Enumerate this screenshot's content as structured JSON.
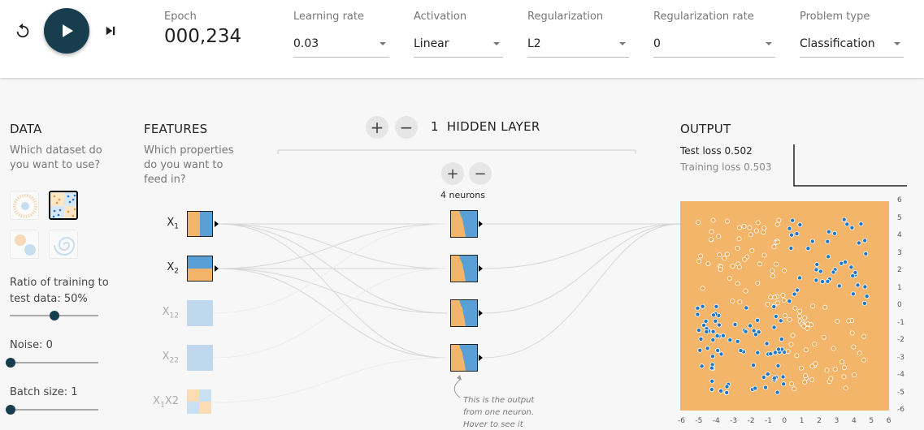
{
  "controls": {
    "reset": "reset-icon",
    "play": "play-icon",
    "step": "step-forward-icon"
  },
  "epoch": {
    "label": "Epoch",
    "value": "000,234"
  },
  "dropdowns": [
    {
      "label": "Learning rate",
      "value": "0.03"
    },
    {
      "label": "Activation",
      "value": "Linear"
    },
    {
      "label": "Regularization",
      "value": "L2"
    },
    {
      "label": "Regularization rate",
      "value": "0"
    },
    {
      "label": "Problem type",
      "value": "Classification"
    }
  ],
  "data": {
    "title": "DATA",
    "subtitle_line1": "Which dataset do",
    "subtitle_line2": "you want to use?",
    "datasets": [
      "circle",
      "xor",
      "gaussian",
      "spiral"
    ],
    "selected": "xor",
    "ratio_label_line1": "Ratio of training to",
    "ratio_label_line2": "test data:  50%",
    "ratio_value": 50,
    "noise_label": "Noise:  0",
    "noise_value": 0,
    "batch_label": "Batch size:  1",
    "batch_value": 1
  },
  "features": {
    "title": "FEATURES",
    "subtitle_line1": "Which properties",
    "subtitle_line2": "do you want to",
    "subtitle_line3": "feed in?",
    "items": [
      {
        "base": "X",
        "sub": "1",
        "sub2": "",
        "active": true
      },
      {
        "base": "X",
        "sub": "2",
        "sub2": "",
        "active": true
      },
      {
        "base": "X",
        "sub": "1",
        "sub2": "2",
        "active": false
      },
      {
        "base": "X",
        "sub": "2",
        "sub2": "2",
        "active": false
      },
      {
        "base": "X",
        "sub": "1",
        "sub2": "X2",
        "active": false
      }
    ]
  },
  "hidden": {
    "add_layer": "+",
    "remove_layer": "−",
    "count": "1",
    "title": "HIDDEN LAYER",
    "add_neuron": "+",
    "remove_neuron": "−",
    "neurons_label": "4 neurons",
    "neuron_count": 4,
    "callout_line1": "This is the output",
    "callout_line2": "from one neuron.",
    "callout_line3": "Hover to see it"
  },
  "output": {
    "title": "OUTPUT",
    "test_loss": "Test loss 0.502",
    "training_loss": "Training loss 0.503",
    "y_ticks": [
      "6",
      "5",
      "4",
      "3",
      "2",
      "1",
      "0",
      "-1",
      "-2",
      "-3",
      "-4",
      "-5",
      "-6"
    ],
    "x_ticks": [
      "-6",
      "-5",
      "-4",
      "-3",
      "-2",
      "-1",
      "0",
      "1",
      "2",
      "3",
      "4",
      "5",
      "6"
    ]
  },
  "colors": {
    "orange": "#f3b56a",
    "blue": "#1f77c4",
    "dark_button": "#183d4e"
  }
}
